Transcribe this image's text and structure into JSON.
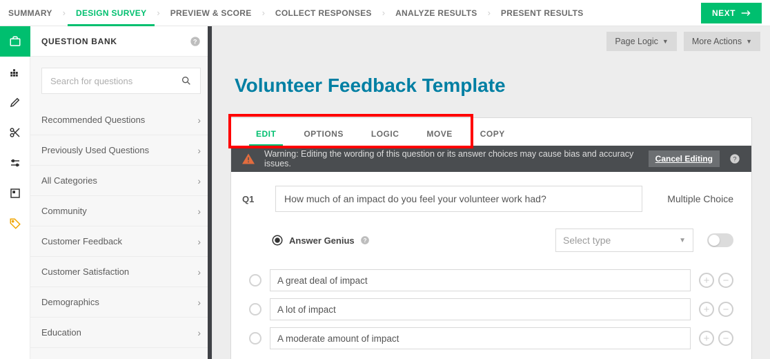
{
  "topnav": {
    "steps": [
      "SUMMARY",
      "DESIGN SURVEY",
      "PREVIEW & SCORE",
      "COLLECT RESPONSES",
      "ANALYZE RESULTS",
      "PRESENT RESULTS"
    ],
    "active_index": 1,
    "next_label": "NEXT"
  },
  "rail": {
    "icons": [
      "briefcase-icon",
      "grid-icon",
      "pencil-icon",
      "scissors-icon",
      "sliders-icon",
      "square-icon",
      "tag-icon"
    ]
  },
  "sidebar": {
    "title": "QUESTION BANK",
    "search_placeholder": "Search for questions",
    "categories": [
      "Recommended Questions",
      "Previously Used Questions",
      "All Categories",
      "Community",
      "Customer Feedback",
      "Customer Satisfaction",
      "Demographics",
      "Education"
    ]
  },
  "toolbar": {
    "page_logic_label": "Page Logic",
    "more_actions_label": "More Actions"
  },
  "survey": {
    "title": "Volunteer Feedback Template"
  },
  "question_tabs": {
    "items": [
      "EDIT",
      "OPTIONS",
      "LOGIC",
      "MOVE",
      "COPY"
    ],
    "active_index": 0
  },
  "warning": {
    "text": "Warning: Editing the wording of this question or its answer choices may cause bias and accuracy issues.",
    "cancel_label": "Cancel Editing"
  },
  "question": {
    "number": "Q1",
    "text": "How much of an impact do you feel your volunteer work had?",
    "type_label": "Multiple Choice",
    "answer_genius_label": "Answer Genius",
    "select_type_placeholder": "Select type",
    "choices": [
      "A great deal of impact",
      "A lot of impact",
      "A moderate amount of impact"
    ]
  }
}
